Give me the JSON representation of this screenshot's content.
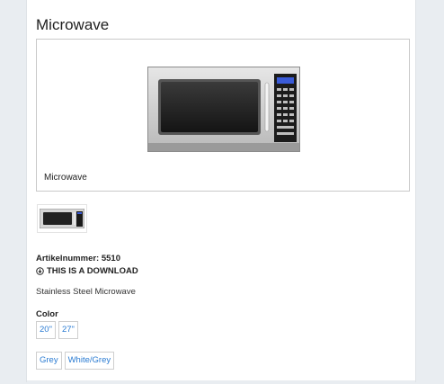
{
  "product": {
    "title": "Microwave",
    "image_caption": "Microwave",
    "sku_line": "Artikelnummer: 5510",
    "download_label": "THIS IS A DOWNLOAD",
    "description": "Stainless Steel Microwave"
  },
  "options": {
    "color_label": "Color",
    "sizes": [
      "20\"",
      "27\""
    ],
    "colors": [
      "Grey",
      "White/Grey"
    ]
  },
  "icons": {
    "download": "download-circle-icon"
  }
}
